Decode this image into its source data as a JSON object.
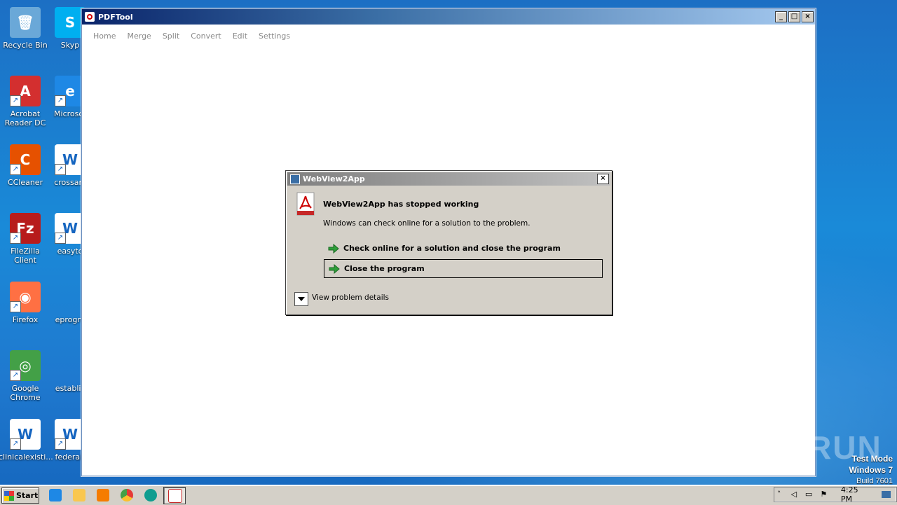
{
  "desktop": {
    "icons_col1": [
      {
        "label": "Recycle Bin",
        "color": "#6aa8d8",
        "glyph": "🗑"
      },
      {
        "label": "Acrobat Reader DC",
        "color": "#d32f2f",
        "glyph": "A"
      },
      {
        "label": "CCleaner",
        "color": "#e65100",
        "glyph": "C"
      },
      {
        "label": "FileZilla Client",
        "color": "#b71c1c",
        "glyph": "Fz"
      },
      {
        "label": "Firefox",
        "color": "#ff7043",
        "glyph": "◉"
      },
      {
        "label": "Google Chrome",
        "color": "#43a047",
        "glyph": "◎"
      },
      {
        "label": "clinicalexisti...",
        "color": "#ffffff",
        "glyph": "W"
      }
    ],
    "icons_col2": [
      {
        "label": "Skyp",
        "color": "#00aff0",
        "glyph": "S"
      },
      {
        "label": "Microsof",
        "color": "#1e88e5",
        "glyph": "e"
      },
      {
        "label": "crossarc",
        "color": "#ffffff",
        "glyph": "W"
      },
      {
        "label": "easyto",
        "color": "#ffffff",
        "glyph": "W"
      },
      {
        "label": "eprogre",
        "color": "",
        "glyph": ""
      },
      {
        "label": "establis",
        "color": "",
        "glyph": ""
      },
      {
        "label": "federalt",
        "color": "#ffffff",
        "glyph": "W"
      }
    ]
  },
  "window": {
    "title": "PDFTool",
    "controls": [
      "_",
      "□",
      "×"
    ],
    "menu": [
      "Home",
      "Merge",
      "Split",
      "Convert",
      "Edit",
      "Settings"
    ]
  },
  "dialog": {
    "title": "WebView2App",
    "heading": "WebView2App has stopped working",
    "subtext": "Windows can check online for a solution to the problem.",
    "option1": "Check online for a solution and close the program",
    "option2": "Close the program",
    "details": "View problem details",
    "close": "×"
  },
  "watermark": {
    "text": "ANY RUN",
    "mode": "Test Mode",
    "os": "Windows 7",
    "build": "Build 7601"
  },
  "taskbar": {
    "start": "Start",
    "clock": "4:25 PM"
  }
}
